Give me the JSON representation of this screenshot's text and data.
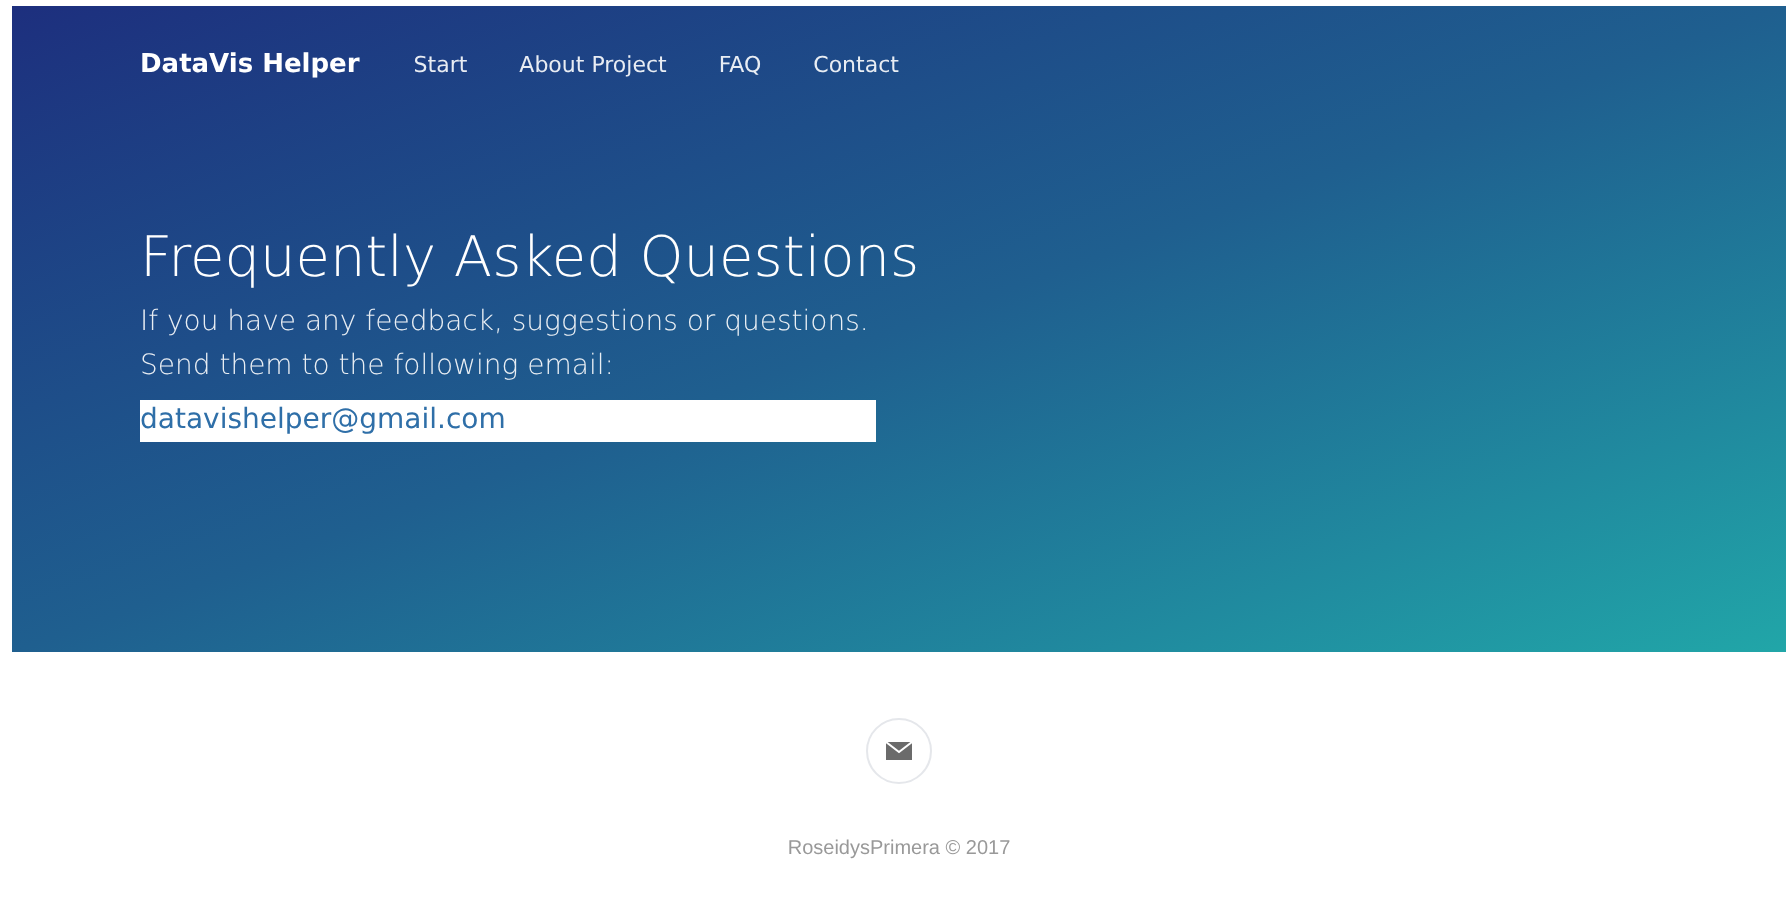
{
  "nav": {
    "brand": "DataVis Helper",
    "links": [
      {
        "label": "Start"
      },
      {
        "label": "About Project"
      },
      {
        "label": "FAQ"
      },
      {
        "label": "Contact"
      }
    ]
  },
  "hero": {
    "title": "Frequently Asked Questions",
    "lines": [
      "If you have any feedback, suggestions or questions.",
      "Send them to the following email:"
    ],
    "email": {
      "value": "datavishelper@gmail.com"
    }
  },
  "footer": {
    "copyright": "RoseidysPrimera © 2017"
  }
}
